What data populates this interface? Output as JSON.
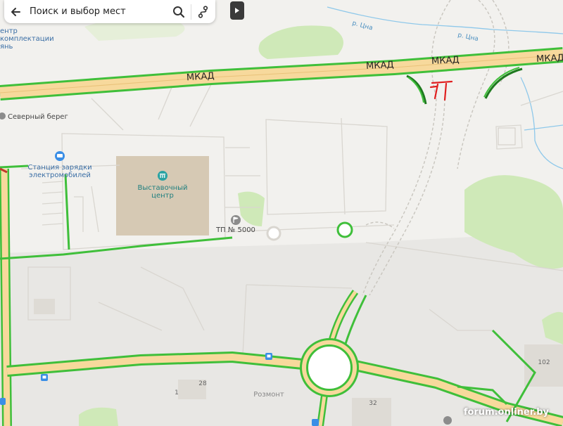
{
  "search": {
    "placeholder": "Поиск и выбор мест"
  },
  "icons": {
    "back": "arrow-left-icon",
    "search": "search-icon",
    "route": "route-icon",
    "toggle": "play-triangle-icon"
  },
  "map": {
    "roads": {
      "mkad": "МКАД"
    },
    "rivers": {
      "tsna_1": "р. Цна",
      "tsna_2": "р. Цна"
    },
    "places": {
      "partial_left_1": "ентр",
      "partial_left_2": "комплектации",
      "partial_left_3": "янь",
      "severny_bereg": "Северный берег",
      "ev_station_1": "Станция зарядки",
      "ev_station_2": "электромобилей",
      "exhibition_1": "Выставочный",
      "exhibition_2": "центр",
      "tp": "ТП № 5000",
      "rozmont": "Розмонт"
    },
    "house_numbers": {
      "h28": "28",
      "h1": "1",
      "h32": "32",
      "h102": "102"
    }
  },
  "colors": {
    "background": "#f2f1ee",
    "road_fill": "#f7d99c",
    "traffic_green": "#3fbf3a",
    "park_green": "#cfe9b8",
    "building": "#d9d3c8",
    "exhibition_building": "#d6c9b4",
    "river": "#8ec8ea",
    "markup_red": "#e02020",
    "poi_blue": "#3a8ee6"
  },
  "watermark": "forum.onliner.by"
}
